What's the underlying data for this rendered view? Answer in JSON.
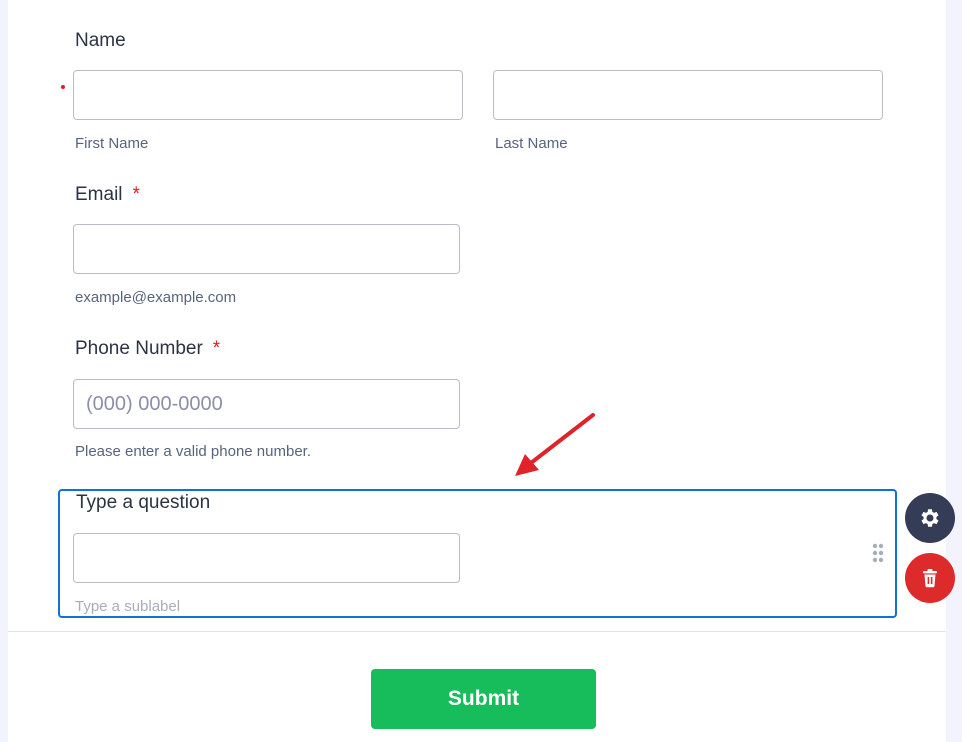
{
  "form": {
    "name": {
      "label": "Name",
      "first_sublabel": "First Name",
      "last_sublabel": "Last Name",
      "first_value": "",
      "last_value": ""
    },
    "email": {
      "label": "Email",
      "required_mark": "*",
      "sublabel": "example@example.com",
      "value": ""
    },
    "phone": {
      "label": "Phone Number",
      "required_mark": "*",
      "placeholder": "(000) 000-0000",
      "sublabel": "Please enter a valid phone number.",
      "value": ""
    },
    "new_question": {
      "label": "Type a question",
      "sublabel_placeholder": "Type a sublabel",
      "value": ""
    },
    "submit_label": "Submit"
  },
  "icons": {
    "settings": "gear-icon",
    "delete": "trash-icon",
    "drag": "drag-handle-icon",
    "annotation": "red-arrow"
  },
  "colors": {
    "required": "#e31b23",
    "selection_border": "#0f72d8",
    "submit_bg": "#18bd5b",
    "settings_bg": "#343c56",
    "delete_bg": "#dd2a2a",
    "arrow": "#e0232b"
  }
}
